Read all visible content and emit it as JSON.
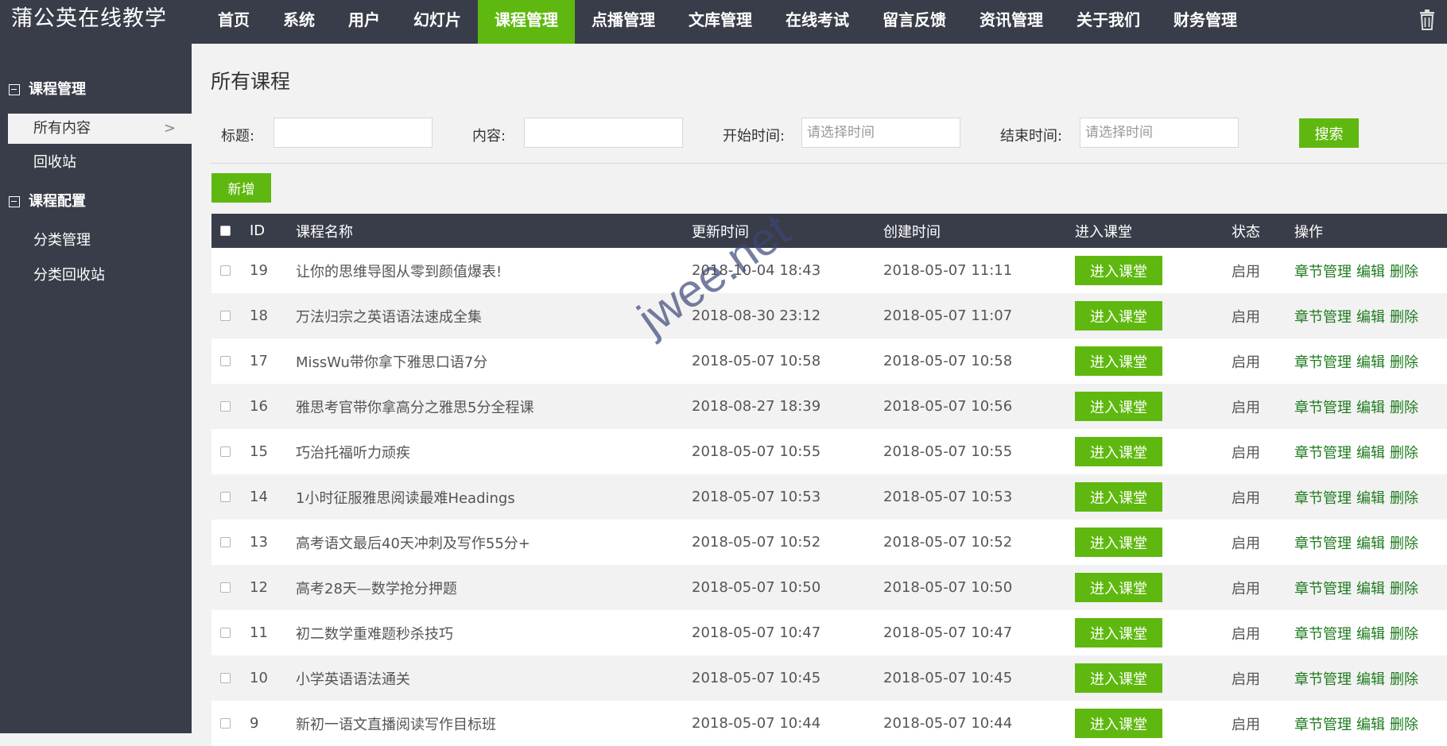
{
  "app": {
    "title": "蒲公英在线教学"
  },
  "nav": {
    "items": [
      {
        "label": "首页",
        "active": false
      },
      {
        "label": "系统",
        "active": false
      },
      {
        "label": "用户",
        "active": false
      },
      {
        "label": "幻灯片",
        "active": false
      },
      {
        "label": "课程管理",
        "active": true
      },
      {
        "label": "点播管理",
        "active": false
      },
      {
        "label": "文库管理",
        "active": false
      },
      {
        "label": "在线考试",
        "active": false
      },
      {
        "label": "留言反馈",
        "active": false
      },
      {
        "label": "资讯管理",
        "active": false
      },
      {
        "label": "关于我们",
        "active": false
      },
      {
        "label": "财务管理",
        "active": false
      }
    ],
    "trash_icon": "trash-icon"
  },
  "sidebar": {
    "groups": [
      {
        "label": "课程管理",
        "items": [
          {
            "label": "所有内容",
            "active": true
          },
          {
            "label": "回收站",
            "active": false
          }
        ]
      },
      {
        "label": "课程配置",
        "items": [
          {
            "label": "分类管理",
            "active": false
          },
          {
            "label": "分类回收站",
            "active": false
          }
        ]
      }
    ],
    "active_chevron": ">"
  },
  "main": {
    "title": "所有课程",
    "filters": {
      "title_label": "标题:",
      "content_label": "内容:",
      "start_label": "开始时间:",
      "start_placeholder": "请选择时间",
      "end_label": "结束时间:",
      "end_placeholder": "请选择时间",
      "search_button": "搜索"
    },
    "add_button": "新增",
    "table": {
      "headers": [
        "ID",
        "课程名称",
        "更新时间",
        "创建时间",
        "进入课堂",
        "状态",
        "操作"
      ],
      "enter_label": "进入课堂",
      "ops": [
        "章节管理",
        "编辑",
        "删除"
      ],
      "rows": [
        {
          "id": "19",
          "name": "让你的思维导图从零到颜值爆表!",
          "updated": "2018-10-04 18:43",
          "created": "2018-05-07 11:11",
          "status": "启用"
        },
        {
          "id": "18",
          "name": "万法归宗之英语语法速成全集",
          "updated": "2018-08-30 23:12",
          "created": "2018-05-07 11:07",
          "status": "启用"
        },
        {
          "id": "17",
          "name": "MissWu带你拿下雅思口语7分",
          "updated": "2018-05-07 10:58",
          "created": "2018-05-07 10:58",
          "status": "启用"
        },
        {
          "id": "16",
          "name": "雅思考官带你拿高分之雅思5分全程课",
          "updated": "2018-08-27 18:39",
          "created": "2018-05-07 10:56",
          "status": "启用"
        },
        {
          "id": "15",
          "name": "巧治托福听力顽疾",
          "updated": "2018-05-07 10:55",
          "created": "2018-05-07 10:55",
          "status": "启用"
        },
        {
          "id": "14",
          "name": "1小时征服雅思阅读最难Headings",
          "updated": "2018-05-07 10:53",
          "created": "2018-05-07 10:53",
          "status": "启用"
        },
        {
          "id": "13",
          "name": "高考语文最后40天冲刺及写作55分+",
          "updated": "2018-05-07 10:52",
          "created": "2018-05-07 10:52",
          "status": "启用"
        },
        {
          "id": "12",
          "name": "高考28天—数学抢分押题",
          "updated": "2018-05-07 10:50",
          "created": "2018-05-07 10:50",
          "status": "启用"
        },
        {
          "id": "11",
          "name": "初二数学重难题秒杀技巧",
          "updated": "2018-05-07 10:47",
          "created": "2018-05-07 10:47",
          "status": "启用"
        },
        {
          "id": "10",
          "name": "小学英语语法通关",
          "updated": "2018-05-07 10:45",
          "created": "2018-05-07 10:45",
          "status": "启用"
        },
        {
          "id": "9",
          "name": "新初一语文直播阅读写作目标班",
          "updated": "2018-05-07 10:44",
          "created": "2018-05-07 10:44",
          "status": "启用"
        }
      ]
    }
  },
  "watermark": "jwee.net",
  "colors": {
    "accent": "#5fb80f",
    "dark": "#393d49",
    "link_dark": "#1e7b1e"
  }
}
